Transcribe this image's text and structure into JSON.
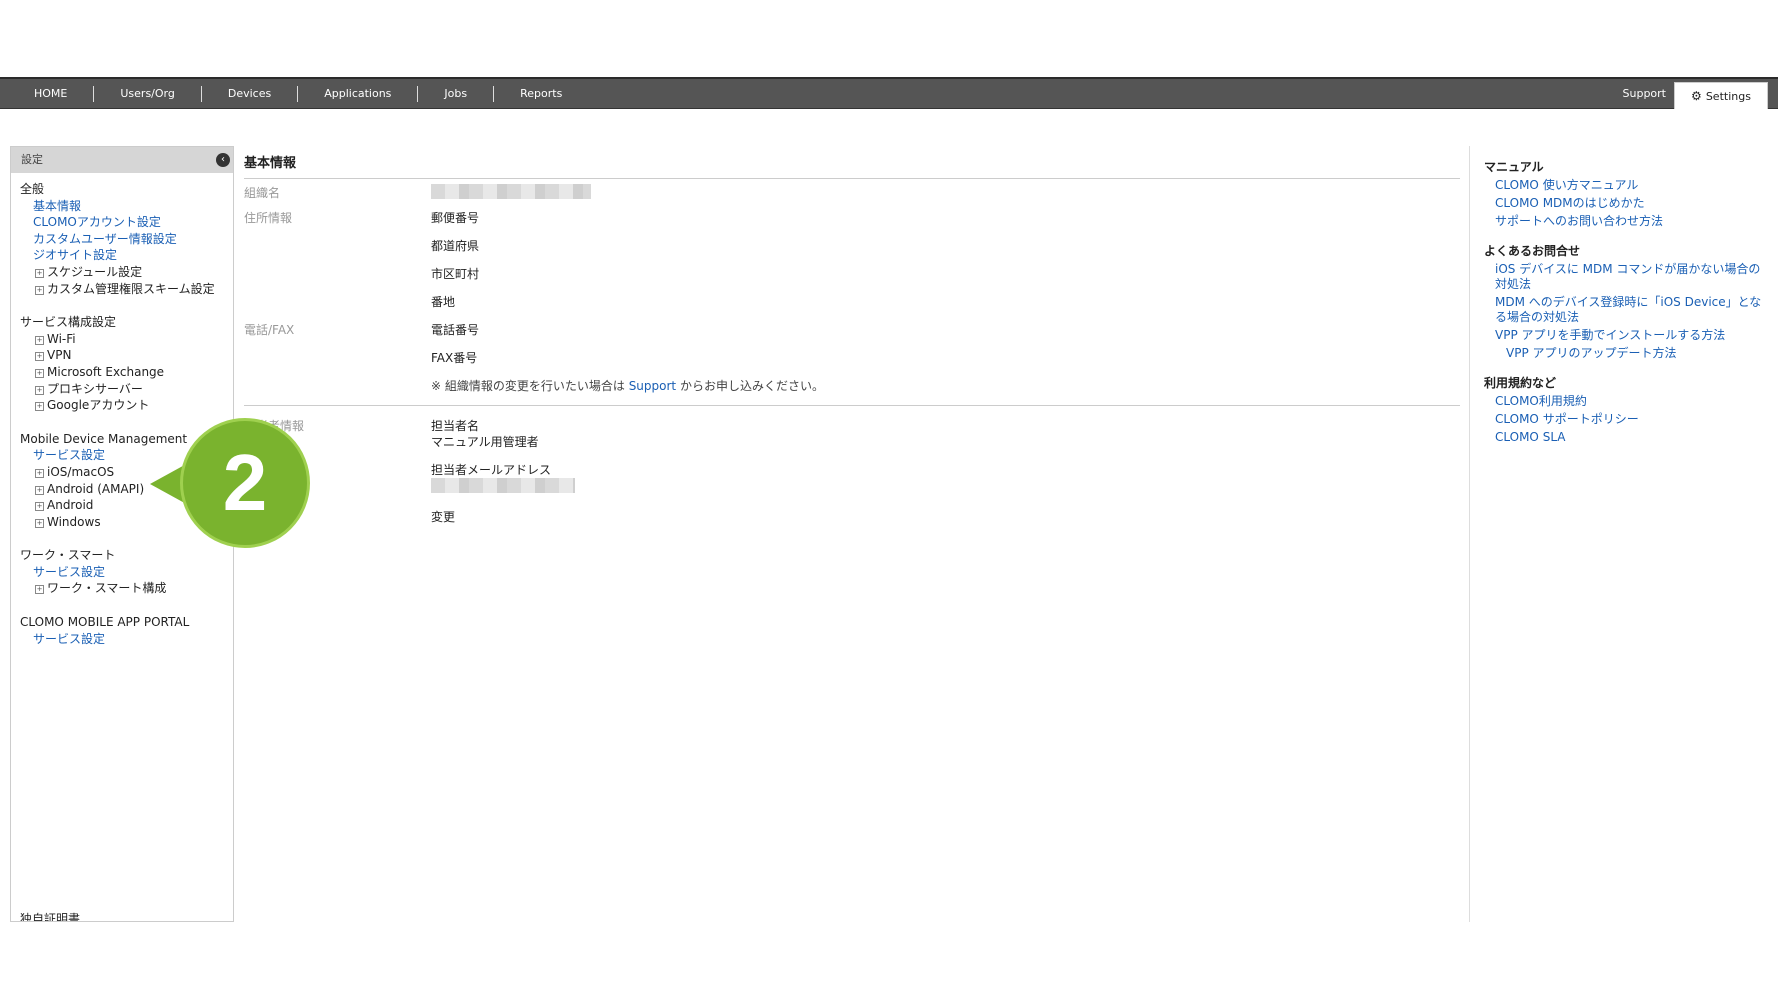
{
  "nav": {
    "items": [
      "HOME",
      "Users/Org",
      "Devices",
      "Applications",
      "Jobs",
      "Reports"
    ],
    "support": "Support",
    "settings": "Settings"
  },
  "sidebar": {
    "header": "設定",
    "sections": [
      {
        "title": "全般",
        "links": [
          "基本情報",
          "CLOMOアカウント設定",
          "カスタムユーザー情報設定",
          "ジオサイト設定"
        ],
        "tree": [
          "スケジュール設定",
          "カスタム管理権限スキーム設定"
        ]
      },
      {
        "title": "サービス構成設定",
        "links": [],
        "tree": [
          "Wi-Fi",
          "VPN",
          "Microsoft Exchange",
          "プロキシサーバー",
          "Googleアカウント"
        ]
      },
      {
        "title": "Mobile Device Management",
        "links": [
          "サービス設定"
        ],
        "tree": [
          "iOS/macOS",
          "Android (AMAPI)",
          "Android",
          "Windows"
        ]
      },
      {
        "title": "ワーク・スマート",
        "links": [
          "サービス設定"
        ],
        "tree": [
          "ワーク・スマート構成"
        ]
      },
      {
        "title": "CLOMO MOBILE APP PORTAL",
        "links": [
          "サービス設定"
        ],
        "tree": []
      }
    ],
    "cut_text": "独自証明書"
  },
  "main": {
    "title": "基本情報",
    "org_label": "組織名",
    "address_label": "住所情報",
    "postal": "郵便番号",
    "prefecture": "都道府県",
    "city": "市区町村",
    "street": "番地",
    "phone_label": "電話/FAX",
    "phone": "電話番号",
    "fax": "FAX番号",
    "note_pre": "※ 組織情報の変更を行いたい場合は ",
    "note_link": "Support",
    "note_post": " からお申し込みください。",
    "contact_label": "担当者情報",
    "contact_name_label": "担当者名",
    "contact_name": "マニュアル用管理者",
    "contact_email_label": "担当者メールアドレス",
    "change_link": "変更"
  },
  "callout": {
    "number": "2"
  },
  "right": {
    "sections": [
      {
        "title": "マニュアル",
        "links": [
          {
            "text": "CLOMO 使い方マニュアル"
          },
          {
            "text": "CLOMO MDMのはじめかた"
          },
          {
            "text": "サポートへのお問い合わせ方法"
          }
        ]
      },
      {
        "title": "よくあるお問合せ",
        "links": [
          {
            "text": "iOS デバイスに MDM コマンドが届かない場合の対処法"
          },
          {
            "text": "MDM へのデバイス登録時に「iOS Device」となる場合の対処法"
          },
          {
            "text": "VPP アプリを手動でインストールする方法"
          },
          {
            "text": "VPP アプリのアップデート方法",
            "sub": true
          }
        ]
      },
      {
        "title": "利用規約など",
        "links": [
          {
            "text": "CLOMO利用規約"
          },
          {
            "text": "CLOMO サポートポリシー"
          },
          {
            "text": "CLOMO SLA"
          }
        ]
      }
    ]
  },
  "colors": {
    "nav_bg": "#555555",
    "link": "#1a5fb4",
    "callout": "#7ab32e"
  }
}
